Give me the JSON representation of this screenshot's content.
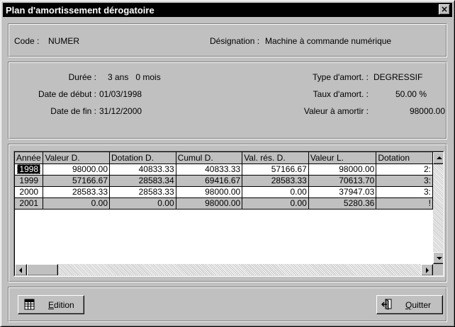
{
  "window": {
    "title": "Plan d'amortissement dérogatoire",
    "close_label": "×"
  },
  "header": {
    "code_label": "Code :",
    "code_value": "NUMER",
    "designation_label": "Désignation :",
    "designation_value": "Machine à commande numérique"
  },
  "details": {
    "duree_label": "Durée :",
    "duree_value": "3 ans   0 mois",
    "date_debut_label": "Date de début :",
    "date_debut_value": "01/03/1998",
    "date_fin_label": "Date de fin :",
    "date_fin_value": "31/12/2000",
    "type_label": "Type d'amort. :",
    "type_value": "DEGRESSIF",
    "taux_label": "Taux d'amort. :",
    "taux_value": "50.00 %",
    "valeur_label": "Valeur à amortir :",
    "valeur_value": "98000.00"
  },
  "grid": {
    "columns": [
      "Année",
      "Valeur D.",
      "Dotation D.",
      "Cumul D.",
      "Val. rés. D.",
      "Valeur L.",
      "Dotation"
    ],
    "rows": [
      {
        "annee": "1998",
        "valeur_d": "98000.00",
        "dotation_d": "40833.33",
        "cumul_d": "40833.33",
        "val_res_d": "57166.67",
        "valeur_l": "98000.00",
        "dotation_l": "2:"
      },
      {
        "annee": "1999",
        "valeur_d": "57166.67",
        "dotation_d": "28583.34",
        "cumul_d": "69416.67",
        "val_res_d": "28583.33",
        "valeur_l": "70613.70",
        "dotation_l": "3:"
      },
      {
        "annee": "2000",
        "valeur_d": "28583.33",
        "dotation_d": "28583.33",
        "cumul_d": "98000.00",
        "val_res_d": "0.00",
        "valeur_l": "37947.03",
        "dotation_l": "3:"
      },
      {
        "annee": "2001",
        "valeur_d": "0.00",
        "dotation_d": "0.00",
        "cumul_d": "98000.00",
        "val_res_d": "0.00",
        "valeur_l": "5280.36",
        "dotation_l": "!"
      }
    ]
  },
  "buttons": {
    "edition_label": "Edition",
    "quitter_label": "Quitter"
  },
  "icons": {
    "edition": "grid-report-icon",
    "quitter": "exit-door-icon"
  }
}
